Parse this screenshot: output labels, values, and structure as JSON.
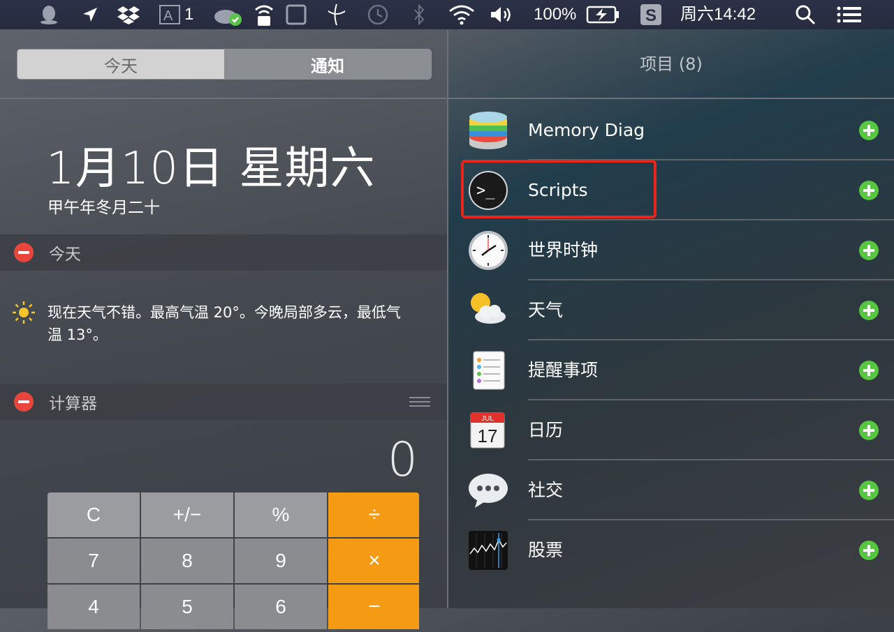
{
  "menubar": {
    "adobe_count": "1",
    "battery": "100%",
    "clock": "周六14:42",
    "icons": [
      "qq-icon",
      "location-arrow-icon",
      "dropbox-icon",
      "adobe-icon",
      "cloud-sync-icon",
      "wifi-lock-icon",
      "screen-icon",
      "finder-icon",
      "time-machine-icon",
      "bluetooth-icon",
      "wifi-icon",
      "volume-icon",
      "battery-charging-icon",
      "s-app-icon",
      "spotlight-icon",
      "notification-center-icon"
    ]
  },
  "left": {
    "tabs": {
      "today": "今天",
      "notifications": "通知"
    },
    "date": "1月10日 星期六",
    "lunar": "甲午年冬月二十",
    "today_section": {
      "title": "今天",
      "weather_text": "现在天气不错。最高气温 20°。今晚局部多云，最低气温 13°。"
    },
    "calc_section": {
      "title": "计算器",
      "display": "0",
      "keys": [
        "C",
        "+/−",
        "%",
        "÷",
        "7",
        "8",
        "9",
        "×",
        "4",
        "5",
        "6",
        "−"
      ]
    }
  },
  "right": {
    "title": "项目 (8)",
    "items": [
      {
        "label": "Memory Diag",
        "icon": "memory-diag-icon"
      },
      {
        "label": "Scripts",
        "icon": "terminal-icon"
      },
      {
        "label": "世界时钟",
        "icon": "clock-icon"
      },
      {
        "label": "天气",
        "icon": "weather-icon"
      },
      {
        "label": "提醒事项",
        "icon": "reminders-icon"
      },
      {
        "label": "日历",
        "icon": "calendar-icon",
        "calendar_month": "JUL",
        "calendar_day": "17"
      },
      {
        "label": "社交",
        "icon": "social-icon"
      },
      {
        "label": "股票",
        "icon": "stocks-icon"
      }
    ]
  },
  "colors": {
    "add": "#57c640",
    "remove": "#e8453c",
    "operator": "#f59b13",
    "highlight": "#e8261c"
  }
}
